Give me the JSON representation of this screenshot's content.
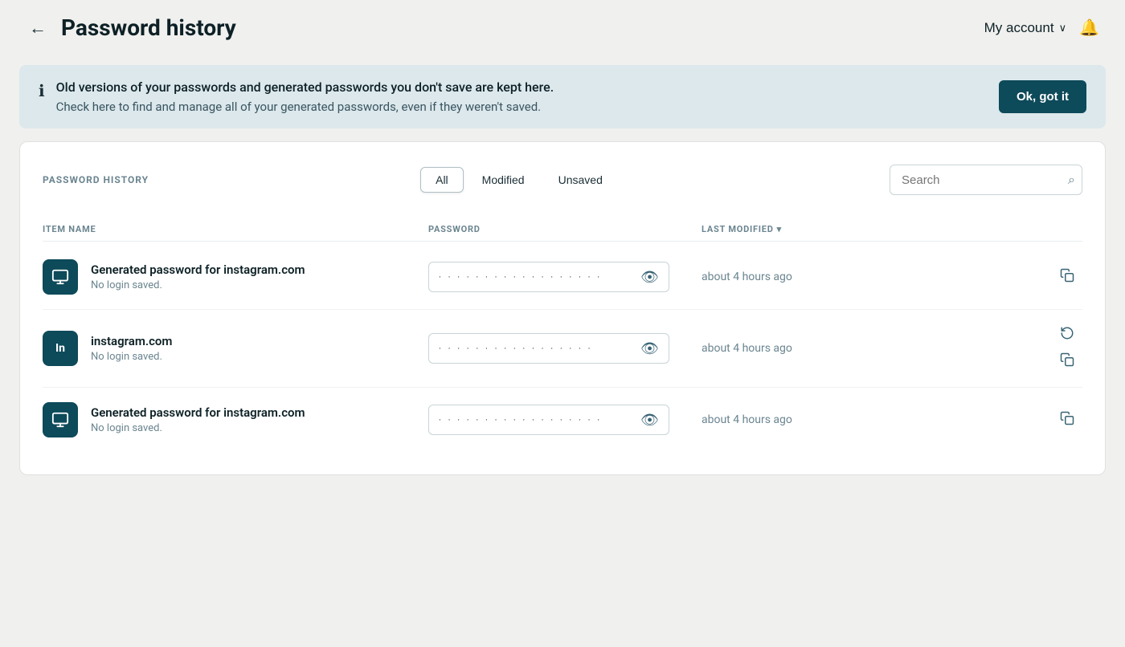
{
  "header": {
    "back_label": "←",
    "title": "Password history",
    "my_account_label": "My account",
    "chevron": "∨",
    "bell": "🔔"
  },
  "banner": {
    "icon": "ℹ",
    "text_primary": "Old versions of your passwords and generated passwords you don't save are kept here.",
    "text_secondary": "Check here to find and manage all of your generated passwords, even if they weren't saved.",
    "ok_label": "Ok, got it"
  },
  "table": {
    "section_label": "PASSWORD HISTORY",
    "filters": [
      {
        "label": "All",
        "active": true
      },
      {
        "label": "Modified",
        "active": false
      },
      {
        "label": "Unsaved",
        "active": false
      }
    ],
    "search_placeholder": "Search",
    "columns": [
      {
        "label": "ITEM NAME"
      },
      {
        "label": "PASSWORD"
      },
      {
        "label": "LAST MODIFIED",
        "sortable": true
      }
    ],
    "rows": [
      {
        "icon_type": "monitor",
        "icon_text": "⊟",
        "name": "Generated password for instagram.com",
        "sub": "No login saved.",
        "password_dots": "· · · · · · · · · · · · · · · · · ·",
        "time": "about 4 hours ago",
        "actions": [
          "copy"
        ]
      },
      {
        "icon_type": "text",
        "icon_text": "In",
        "name": "instagram.com",
        "sub": "No login saved.",
        "password_dots": "· · · · · · · · · · · · · · · · ·",
        "time": "about 4 hours ago",
        "actions": [
          "restore",
          "copy"
        ]
      },
      {
        "icon_type": "monitor",
        "icon_text": "⊟",
        "name": "Generated password for instagram.com",
        "sub": "No login saved.",
        "password_dots": "· · · · · · · · · · · · · · · · · ·",
        "time": "about 4 hours ago",
        "actions": [
          "copy"
        ]
      }
    ]
  }
}
